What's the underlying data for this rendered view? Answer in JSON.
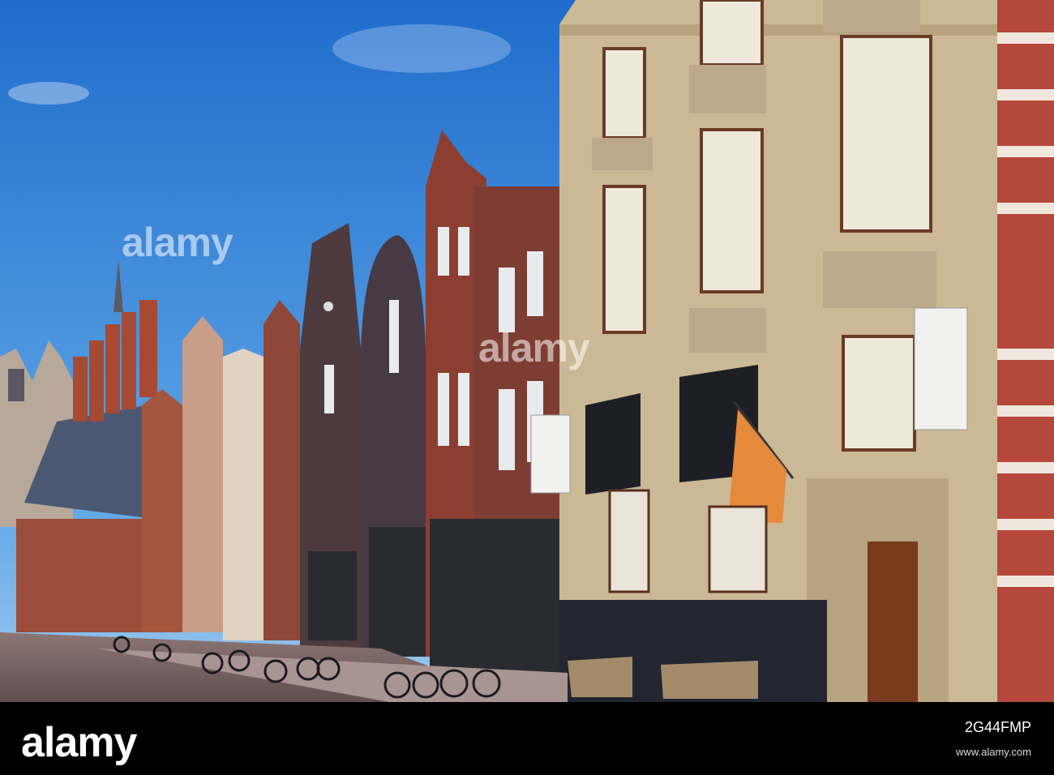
{
  "watermark": {
    "text": "alamy"
  },
  "footer": {
    "brand": "alamy",
    "image_id": "2G44FMP",
    "meta": "www.alamy.com"
  },
  "colors": {
    "sky": "#2f7fd8",
    "sky_light": "#7bb6ea",
    "stone": "#cdbb98",
    "brick": "#9a4a35",
    "dark_brick": "#4a3a3e",
    "flag": "#e58a3c",
    "street": "#7a6a68"
  },
  "icons": {
    "flag": "flag-icon",
    "bicycle": "bicycle-icon"
  }
}
